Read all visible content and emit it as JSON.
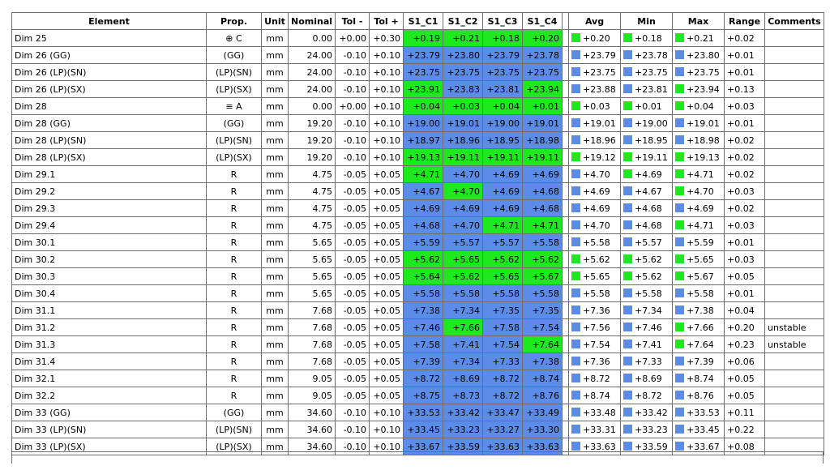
{
  "header": {
    "element": "Element",
    "prop": "Prop.",
    "unit": "Unit",
    "nominal": "Nominal",
    "tol_minus": "Tol -",
    "tol_plus": "Tol +",
    "c1": "S1_C1",
    "c2": "S1_C2",
    "c3": "S1_C3",
    "c4": "S1_C4",
    "avg": "Avg",
    "min": "Min",
    "max": "Max",
    "range": "Range",
    "comments": "Comments"
  },
  "colors": {
    "in_tol_blue": "#5b8ce8",
    "highlight_green": "#1ee81e",
    "grid": "#6e6e6e"
  },
  "rows": [
    {
      "element": "Dim 25",
      "prop": "⊕ C",
      "unit": "mm",
      "nominal": "0.00",
      "tol_minus": "+0.00",
      "tol_plus": "+0.30",
      "c1": "+0.19",
      "c2": "+0.21",
      "c3": "+0.18",
      "c4": "+0.20",
      "c_colors": [
        "green",
        "green",
        "green",
        "green"
      ],
      "avg": "+0.20",
      "avg_color": "green",
      "min": "+0.18",
      "min_color": "green",
      "max": "+0.21",
      "max_color": "green",
      "range": "+0.02",
      "comments": ""
    },
    {
      "element": "Dim 26 (GG)",
      "prop": "(GG)",
      "unit": "mm",
      "nominal": "24.00",
      "tol_minus": "-0.10",
      "tol_plus": "+0.10",
      "c1": "+23.79",
      "c2": "+23.80",
      "c3": "+23.79",
      "c4": "+23.78",
      "c_colors": [
        "blue",
        "blue",
        "blue",
        "blue"
      ],
      "avg": "+23.79",
      "avg_color": "blue",
      "min": "+23.78",
      "min_color": "blue",
      "max": "+23.80",
      "max_color": "blue",
      "range": "+0.01",
      "comments": ""
    },
    {
      "element": "Dim 26 (LP)(SN)",
      "prop": "(LP)(SN)",
      "unit": "mm",
      "nominal": "24.00",
      "tol_minus": "-0.10",
      "tol_plus": "+0.10",
      "c1": "+23.75",
      "c2": "+23.75",
      "c3": "+23.75",
      "c4": "+23.75",
      "c_colors": [
        "blue",
        "blue",
        "blue",
        "blue"
      ],
      "avg": "+23.75",
      "avg_color": "blue",
      "min": "+23.75",
      "min_color": "blue",
      "max": "+23.75",
      "max_color": "blue",
      "range": "+0.01",
      "comments": ""
    },
    {
      "element": "Dim 26 (LP)(SX)",
      "prop": "(LP)(SX)",
      "unit": "mm",
      "nominal": "24.00",
      "tol_minus": "-0.10",
      "tol_plus": "+0.10",
      "c1": "+23.91",
      "c2": "+23.83",
      "c3": "+23.81",
      "c4": "+23.94",
      "c_colors": [
        "green",
        "blue",
        "blue",
        "green"
      ],
      "avg": "+23.88",
      "avg_color": "blue",
      "min": "+23.81",
      "min_color": "blue",
      "max": "+23.94",
      "max_color": "green",
      "range": "+0.13",
      "comments": ""
    },
    {
      "element": "Dim 28",
      "prop": "≡ A",
      "unit": "mm",
      "nominal": "0.00",
      "tol_minus": "+0.00",
      "tol_plus": "+0.10",
      "c1": "+0.04",
      "c2": "+0.03",
      "c3": "+0.04",
      "c4": "+0.01",
      "c_colors": [
        "green",
        "green",
        "green",
        "green"
      ],
      "avg": "+0.03",
      "avg_color": "green",
      "min": "+0.01",
      "min_color": "green",
      "max": "+0.04",
      "max_color": "green",
      "range": "+0.03",
      "comments": ""
    },
    {
      "element": "Dim 28 (GG)",
      "prop": "(GG)",
      "unit": "mm",
      "nominal": "19.20",
      "tol_minus": "-0.10",
      "tol_plus": "+0.10",
      "c1": "+19.00",
      "c2": "+19.01",
      "c3": "+19.00",
      "c4": "+19.01",
      "c_colors": [
        "blue",
        "blue",
        "blue",
        "blue"
      ],
      "avg": "+19.01",
      "avg_color": "blue",
      "min": "+19.00",
      "min_color": "blue",
      "max": "+19.01",
      "max_color": "blue",
      "range": "+0.01",
      "comments": ""
    },
    {
      "element": "Dim 28 (LP)(SN)",
      "prop": "(LP)(SN)",
      "unit": "mm",
      "nominal": "19.20",
      "tol_minus": "-0.10",
      "tol_plus": "+0.10",
      "c1": "+18.97",
      "c2": "+18.96",
      "c3": "+18.95",
      "c4": "+18.98",
      "c_colors": [
        "blue",
        "blue",
        "blue",
        "blue"
      ],
      "avg": "+18.96",
      "avg_color": "blue",
      "min": "+18.95",
      "min_color": "blue",
      "max": "+18.98",
      "max_color": "blue",
      "range": "+0.02",
      "comments": ""
    },
    {
      "element": "Dim 28 (LP)(SX)",
      "prop": "(LP)(SX)",
      "unit": "mm",
      "nominal": "19.20",
      "tol_minus": "-0.10",
      "tol_plus": "+0.10",
      "c1": "+19.13",
      "c2": "+19.11",
      "c3": "+19.11",
      "c4": "+19.11",
      "c_colors": [
        "green",
        "green",
        "green",
        "green"
      ],
      "avg": "+19.12",
      "avg_color": "green",
      "min": "+19.11",
      "min_color": "green",
      "max": "+19.13",
      "max_color": "green",
      "range": "+0.02",
      "comments": ""
    },
    {
      "element": "Dim 29.1",
      "prop": "R",
      "unit": "mm",
      "nominal": "4.75",
      "tol_minus": "-0.05",
      "tol_plus": "+0.05",
      "c1": "+4.71",
      "c2": "+4.70",
      "c3": "+4.69",
      "c4": "+4.69",
      "c_colors": [
        "green",
        "blue",
        "blue",
        "blue"
      ],
      "avg": "+4.70",
      "avg_color": "blue",
      "min": "+4.69",
      "min_color": "green",
      "max": "+4.71",
      "max_color": "green",
      "range": "+0.02",
      "comments": ""
    },
    {
      "element": "Dim 29.2",
      "prop": "R",
      "unit": "mm",
      "nominal": "4.75",
      "tol_minus": "-0.05",
      "tol_plus": "+0.05",
      "c1": "+4.67",
      "c2": "+4.70",
      "c3": "+4.69",
      "c4": "+4.68",
      "c_colors": [
        "blue",
        "green",
        "blue",
        "blue"
      ],
      "avg": "+4.69",
      "avg_color": "blue",
      "min": "+4.67",
      "min_color": "blue",
      "max": "+4.70",
      "max_color": "green",
      "range": "+0.03",
      "comments": ""
    },
    {
      "element": "Dim 29.3",
      "prop": "R",
      "unit": "mm",
      "nominal": "4.75",
      "tol_minus": "-0.05",
      "tol_plus": "+0.05",
      "c1": "+4.69",
      "c2": "+4.69",
      "c3": "+4.69",
      "c4": "+4.68",
      "c_colors": [
        "blue",
        "blue",
        "blue",
        "blue"
      ],
      "avg": "+4.69",
      "avg_color": "blue",
      "min": "+4.68",
      "min_color": "blue",
      "max": "+4.69",
      "max_color": "blue",
      "range": "+0.02",
      "comments": ""
    },
    {
      "element": "Dim 29.4",
      "prop": "R",
      "unit": "mm",
      "nominal": "4.75",
      "tol_minus": "-0.05",
      "tol_plus": "+0.05",
      "c1": "+4.68",
      "c2": "+4.70",
      "c3": "+4.71",
      "c4": "+4.71",
      "c_colors": [
        "blue",
        "blue",
        "green",
        "green"
      ],
      "avg": "+4.70",
      "avg_color": "blue",
      "min": "+4.68",
      "min_color": "blue",
      "max": "+4.71",
      "max_color": "green",
      "range": "+0.03",
      "comments": ""
    },
    {
      "element": "Dim 30.1",
      "prop": "R",
      "unit": "mm",
      "nominal": "5.65",
      "tol_minus": "-0.05",
      "tol_plus": "+0.05",
      "c1": "+5.59",
      "c2": "+5.57",
      "c3": "+5.57",
      "c4": "+5.58",
      "c_colors": [
        "blue",
        "blue",
        "blue",
        "blue"
      ],
      "avg": "+5.58",
      "avg_color": "blue",
      "min": "+5.57",
      "min_color": "blue",
      "max": "+5.59",
      "max_color": "blue",
      "range": "+0.01",
      "comments": ""
    },
    {
      "element": "Dim 30.2",
      "prop": "R",
      "unit": "mm",
      "nominal": "5.65",
      "tol_minus": "-0.05",
      "tol_plus": "+0.05",
      "c1": "+5.62",
      "c2": "+5.65",
      "c3": "+5.62",
      "c4": "+5.62",
      "c_colors": [
        "green",
        "green",
        "green",
        "green"
      ],
      "avg": "+5.62",
      "avg_color": "green",
      "min": "+5.62",
      "min_color": "green",
      "max": "+5.65",
      "max_color": "green",
      "range": "+0.03",
      "comments": ""
    },
    {
      "element": "Dim 30.3",
      "prop": "R",
      "unit": "mm",
      "nominal": "5.65",
      "tol_minus": "-0.05",
      "tol_plus": "+0.05",
      "c1": "+5.64",
      "c2": "+5.62",
      "c3": "+5.65",
      "c4": "+5.67",
      "c_colors": [
        "green",
        "green",
        "green",
        "green"
      ],
      "avg": "+5.65",
      "avg_color": "green",
      "min": "+5.62",
      "min_color": "green",
      "max": "+5.67",
      "max_color": "green",
      "range": "+0.05",
      "comments": ""
    },
    {
      "element": "Dim 30.4",
      "prop": "R",
      "unit": "mm",
      "nominal": "5.65",
      "tol_minus": "-0.05",
      "tol_plus": "+0.05",
      "c1": "+5.58",
      "c2": "+5.58",
      "c3": "+5.58",
      "c4": "+5.58",
      "c_colors": [
        "blue",
        "blue",
        "blue",
        "blue"
      ],
      "avg": "+5.58",
      "avg_color": "blue",
      "min": "+5.58",
      "min_color": "blue",
      "max": "+5.58",
      "max_color": "blue",
      "range": "+0.01",
      "comments": ""
    },
    {
      "element": "Dim 31.1",
      "prop": "R",
      "unit": "mm",
      "nominal": "7.68",
      "tol_minus": "-0.05",
      "tol_plus": "+0.05",
      "c1": "+7.38",
      "c2": "+7.34",
      "c3": "+7.35",
      "c4": "+7.35",
      "c_colors": [
        "blue",
        "blue",
        "blue",
        "blue"
      ],
      "avg": "+7.36",
      "avg_color": "blue",
      "min": "+7.34",
      "min_color": "blue",
      "max": "+7.38",
      "max_color": "blue",
      "range": "+0.04",
      "comments": ""
    },
    {
      "element": "Dim 31.2",
      "prop": "R",
      "unit": "mm",
      "nominal": "7.68",
      "tol_minus": "-0.05",
      "tol_plus": "+0.05",
      "c1": "+7.46",
      "c2": "+7.66",
      "c3": "+7.58",
      "c4": "+7.54",
      "c_colors": [
        "blue",
        "green",
        "blue",
        "blue"
      ],
      "avg": "+7.56",
      "avg_color": "blue",
      "min": "+7.46",
      "min_color": "blue",
      "max": "+7.66",
      "max_color": "green",
      "range": "+0.20",
      "comments": "unstable"
    },
    {
      "element": "Dim 31.3",
      "prop": "R",
      "unit": "mm",
      "nominal": "7.68",
      "tol_minus": "-0.05",
      "tol_plus": "+0.05",
      "c1": "+7.58",
      "c2": "+7.41",
      "c3": "+7.54",
      "c4": "+7.64",
      "c_colors": [
        "blue",
        "blue",
        "blue",
        "green"
      ],
      "avg": "+7.54",
      "avg_color": "blue",
      "min": "+7.41",
      "min_color": "blue",
      "max": "+7.64",
      "max_color": "green",
      "range": "+0.23",
      "comments": "unstable"
    },
    {
      "element": "Dim 31.4",
      "prop": "R",
      "unit": "mm",
      "nominal": "7.68",
      "tol_minus": "-0.05",
      "tol_plus": "+0.05",
      "c1": "+7.39",
      "c2": "+7.34",
      "c3": "+7.33",
      "c4": "+7.38",
      "c_colors": [
        "blue",
        "blue",
        "blue",
        "blue"
      ],
      "avg": "+7.36",
      "avg_color": "blue",
      "min": "+7.33",
      "min_color": "blue",
      "max": "+7.39",
      "max_color": "blue",
      "range": "+0.06",
      "comments": ""
    },
    {
      "element": "Dim 32.1",
      "prop": "R",
      "unit": "mm",
      "nominal": "9.05",
      "tol_minus": "-0.05",
      "tol_plus": "+0.05",
      "c1": "+8.72",
      "c2": "+8.69",
      "c3": "+8.72",
      "c4": "+8.74",
      "c_colors": [
        "blue",
        "blue",
        "blue",
        "blue"
      ],
      "avg": "+8.72",
      "avg_color": "blue",
      "min": "+8.69",
      "min_color": "blue",
      "max": "+8.74",
      "max_color": "blue",
      "range": "+0.05",
      "comments": ""
    },
    {
      "element": "Dim 32.2",
      "prop": "R",
      "unit": "mm",
      "nominal": "9.05",
      "tol_minus": "-0.05",
      "tol_plus": "+0.05",
      "c1": "+8.75",
      "c2": "+8.73",
      "c3": "+8.72",
      "c4": "+8.76",
      "c_colors": [
        "blue",
        "blue",
        "blue",
        "blue"
      ],
      "avg": "+8.74",
      "avg_color": "blue",
      "min": "+8.72",
      "min_color": "blue",
      "max": "+8.76",
      "max_color": "blue",
      "range": "+0.05",
      "comments": ""
    },
    {
      "element": "Dim 33 (GG)",
      "prop": "(GG)",
      "unit": "mm",
      "nominal": "34.60",
      "tol_minus": "-0.10",
      "tol_plus": "+0.10",
      "c1": "+33.53",
      "c2": "+33.42",
      "c3": "+33.47",
      "c4": "+33.49",
      "c_colors": [
        "blue",
        "blue",
        "blue",
        "blue"
      ],
      "avg": "+33.48",
      "avg_color": "blue",
      "min": "+33.42",
      "min_color": "blue",
      "max": "+33.53",
      "max_color": "blue",
      "range": "+0.11",
      "comments": ""
    },
    {
      "element": "Dim 33 (LP)(SN)",
      "prop": "(LP)(SN)",
      "unit": "mm",
      "nominal": "34.60",
      "tol_minus": "-0.10",
      "tol_plus": "+0.10",
      "c1": "+33.45",
      "c2": "+33.23",
      "c3": "+33.27",
      "c4": "+33.30",
      "c_colors": [
        "blue",
        "blue",
        "blue",
        "blue"
      ],
      "avg": "+33.31",
      "avg_color": "blue",
      "min": "+33.23",
      "min_color": "blue",
      "max": "+33.45",
      "max_color": "blue",
      "range": "+0.22",
      "comments": ""
    },
    {
      "element": "Dim 33 (LP)(SX)",
      "prop": "(LP)(SX)",
      "unit": "mm",
      "nominal": "34.60",
      "tol_minus": "-0.10",
      "tol_plus": "+0.10",
      "c1": "+33.67",
      "c2": "+33.59",
      "c3": "+33.63",
      "c4": "+33.63",
      "c_colors": [
        "blue",
        "blue",
        "blue",
        "blue"
      ],
      "avg": "+33.63",
      "avg_color": "blue",
      "min": "+33.59",
      "min_color": "blue",
      "max": "+33.67",
      "max_color": "blue",
      "range": "+0.08",
      "comments": ""
    }
  ]
}
